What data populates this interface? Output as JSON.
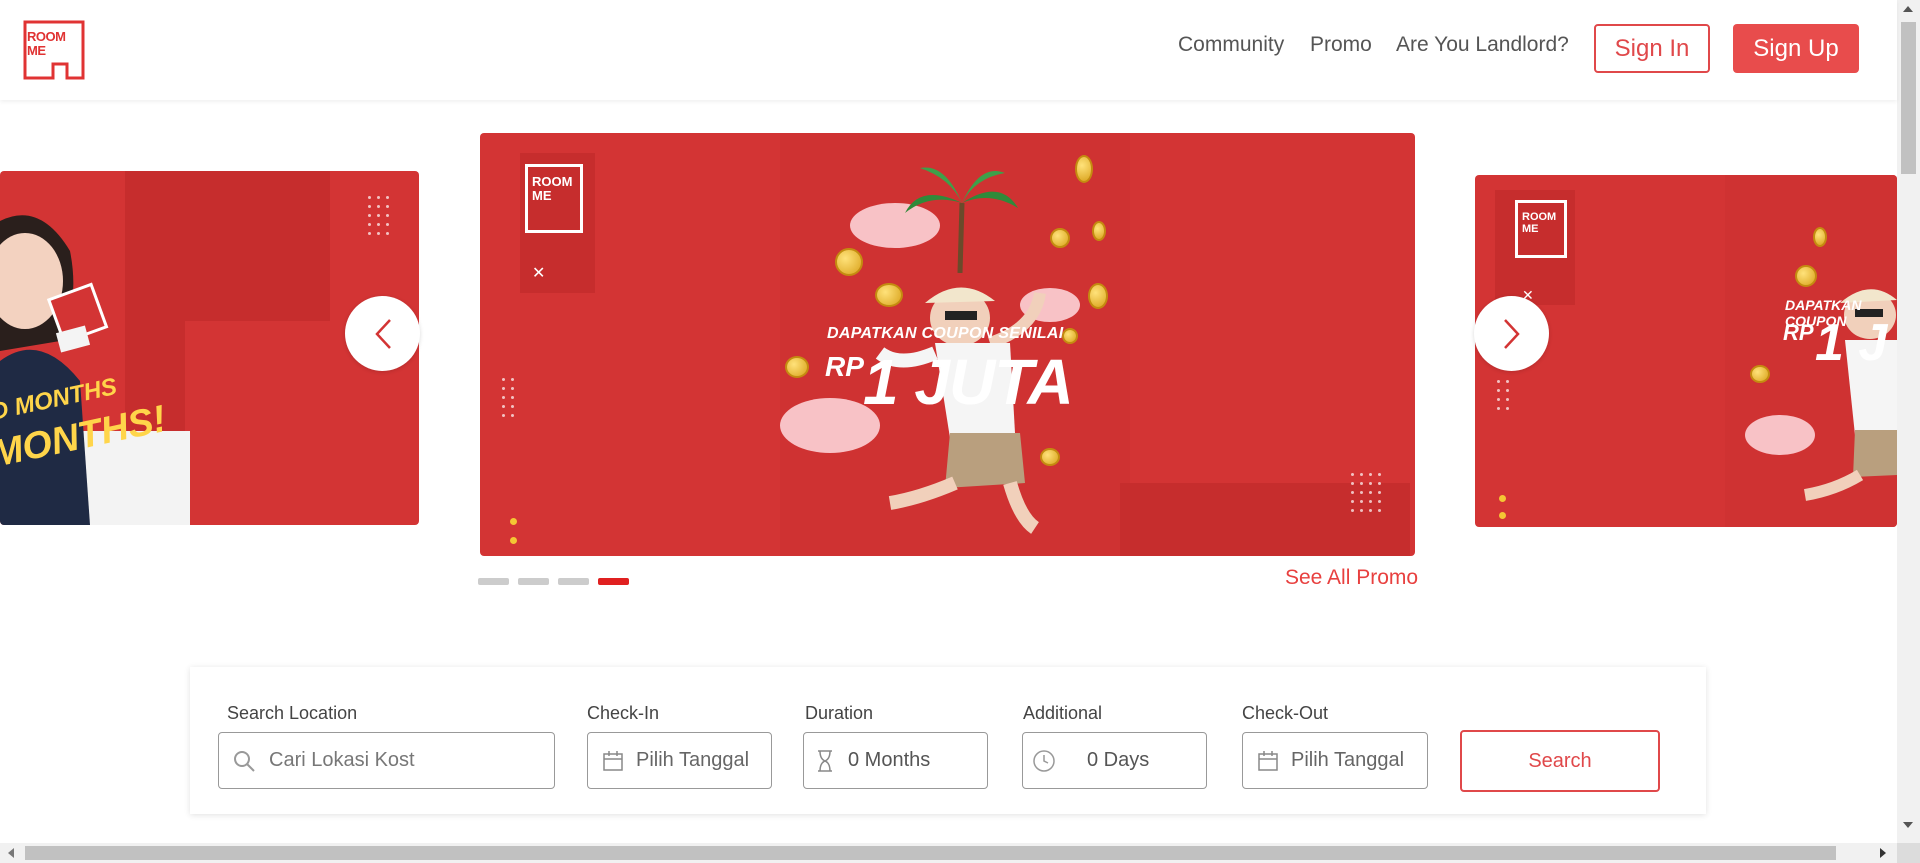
{
  "header": {
    "logo_text_line1": "ROOM",
    "logo_text_line2": "ME",
    "nav": [
      "Community",
      "Promo",
      "Are You Landlord?"
    ],
    "sign_in": "Sign In",
    "sign_up": "Sign Up"
  },
  "carousel": {
    "slides": [
      {
        "logo_line1": "ROOM",
        "logo_line2": "ME",
        "headline_top": "D MONTHS",
        "headline_bottom": "MONTHS!"
      },
      {
        "logo_line1": "ROOM",
        "logo_line2": "ME",
        "headline_small": "DAPATKAN COUPON SENILAI",
        "headline_big_prefix": "RP",
        "headline_big": "1 JUTA"
      },
      {
        "logo_line1": "ROOM",
        "logo_line2": "ME",
        "headline_small": "DAPATKAN COUPON",
        "headline_big_prefix": "RP",
        "headline_big": "1 J"
      }
    ],
    "indicator_count": 4,
    "active_indicator": 4,
    "see_all": "See All Promo"
  },
  "search": {
    "location_label": "Search Location",
    "location_placeholder": "Cari Lokasi Kost",
    "checkin_label": "Check-In",
    "checkin_value": "Pilih Tanggal",
    "duration_label": "Duration",
    "duration_value": "0 Months",
    "additional_label": "Additional",
    "additional_value": "0 Days",
    "checkout_label": "Check-Out",
    "checkout_value": "Pilih Tanggal",
    "search_button": "Search"
  },
  "colors": {
    "brand_red": "#e0484a",
    "banner_red": "#d33434",
    "indicator_active": "#e02020"
  }
}
